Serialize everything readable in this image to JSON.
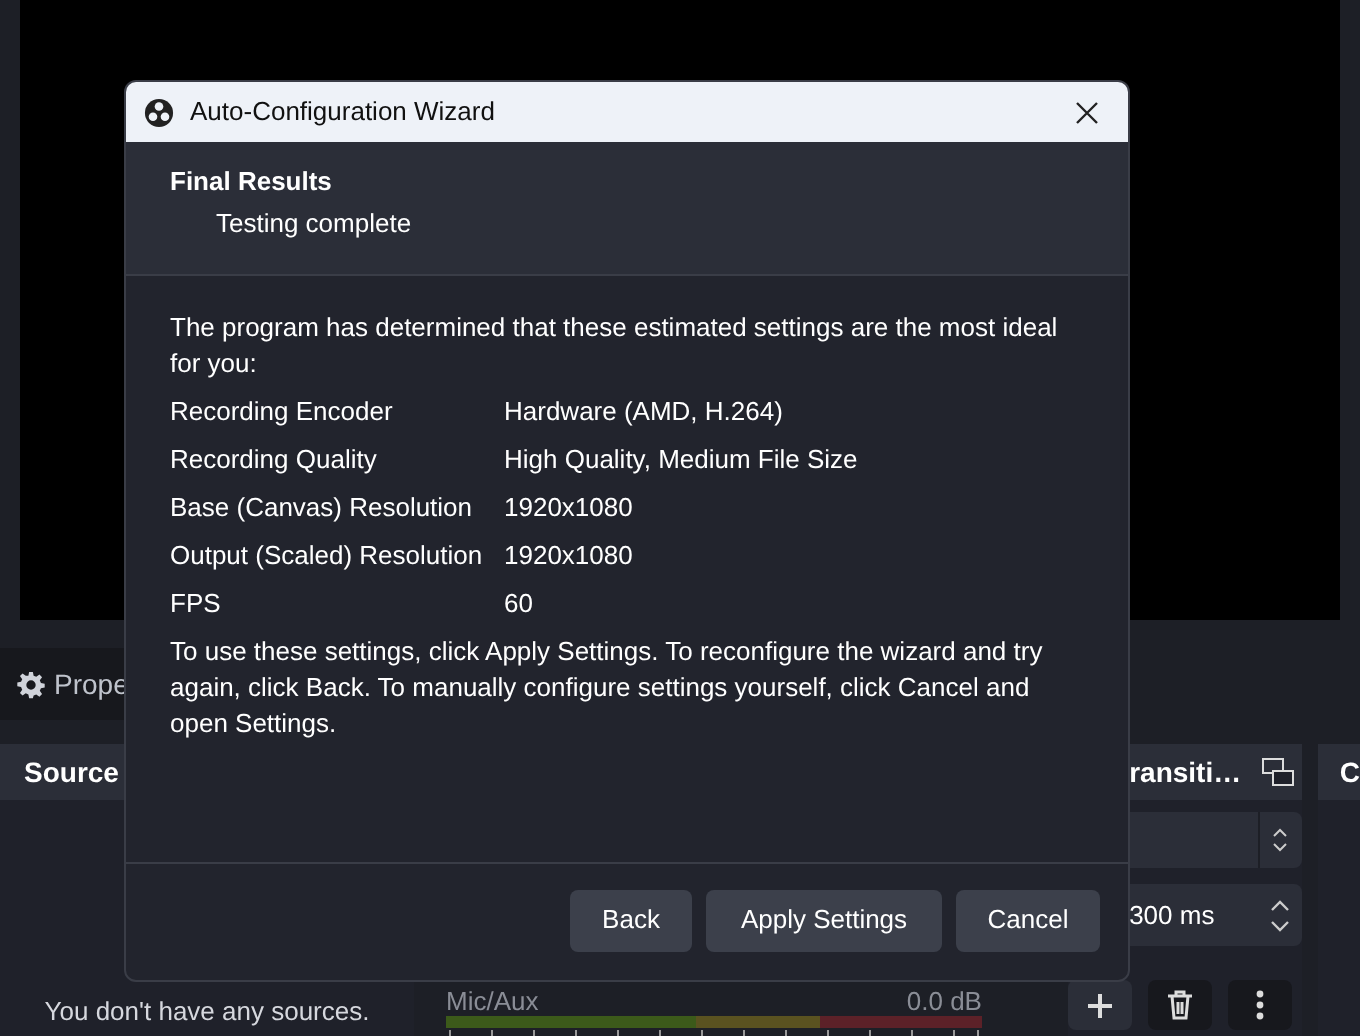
{
  "background": {
    "properties_tab": "Prope",
    "sources_panel": {
      "title": "Source",
      "empty_text": "You don't have any sources."
    },
    "mixer": {
      "channel": "Mic/Aux",
      "reading": "0.0 dB"
    },
    "transitions_panel": {
      "title": "ransiti…",
      "duration": "300 ms"
    },
    "next_panel": {
      "title": "C"
    }
  },
  "dialog": {
    "title": "Auto-Configuration Wizard",
    "heading": "Final Results",
    "subheading": "Testing complete",
    "intro": "The program has determined that these estimated settings are the most ideal for you:",
    "results": [
      {
        "label": "Recording Encoder",
        "value": "Hardware (AMD, H.264)"
      },
      {
        "label": "Recording Quality",
        "value": "High Quality, Medium File Size"
      },
      {
        "label": "Base (Canvas) Resolution",
        "value": "1920x1080"
      },
      {
        "label": "Output (Scaled) Resolution",
        "value": "1920x1080"
      },
      {
        "label": "FPS",
        "value": "60"
      }
    ],
    "outro": "To use these settings, click Apply Settings. To reconfigure the wizard and try again, click Back. To manually configure settings yourself, click Cancel and open Settings.",
    "buttons": [
      "Back",
      "Apply Settings",
      "Cancel"
    ]
  }
}
